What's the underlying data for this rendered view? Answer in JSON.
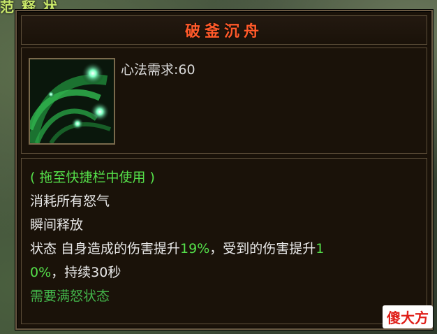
{
  "background": {
    "partial_text": "范 释 状"
  },
  "tooltip": {
    "title": "破釜沉舟",
    "requirement": "心法需求:60",
    "icon": "green-swirl-skill-icon",
    "hint": "( 拖至快捷栏中使用 )",
    "line1": "消耗所有怒气",
    "line2": "瞬间释放",
    "status_prefix": "状态 自身造成的伤害提升",
    "status_value1": "19%",
    "status_middle": "，受到的伤害提升",
    "status_value2_part1": "1",
    "status_value2_part2": "0%",
    "status_suffix": "，持续30秒",
    "need": "需要满怒状态"
  },
  "watermark": {
    "char1": "傻",
    "char2": "大",
    "char3": "方"
  },
  "colors": {
    "title": "#ff5a2a",
    "highlight": "#55e04a",
    "text": "#e8e8e8",
    "panel_bg": "#1a1209",
    "border": "#6b5a43"
  }
}
